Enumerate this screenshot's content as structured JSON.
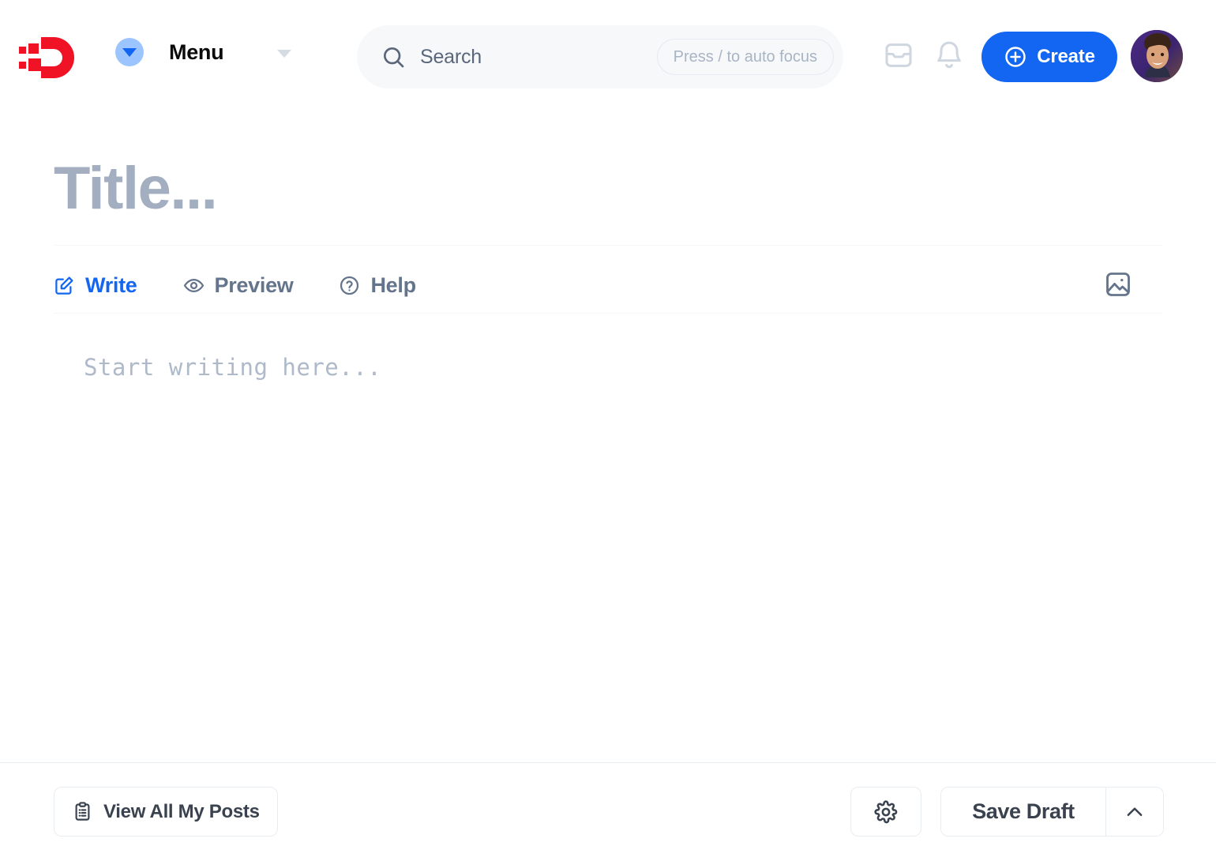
{
  "header": {
    "logo_icon": "dev-to-logo-icon",
    "menu": {
      "label": "Menu",
      "toggle_icon": "caret-down-filled-icon",
      "dropdown_icon": "chevron-down-icon"
    },
    "search": {
      "icon": "search-icon",
      "placeholder": "Search",
      "hint": "Press / to auto focus"
    },
    "inbox_icon": "inbox-icon",
    "notifications_icon": "bell-icon",
    "create": {
      "label": "Create",
      "icon": "plus-circle-icon"
    },
    "avatar": "user-avatar"
  },
  "editor": {
    "title_placeholder": "Title...",
    "body_placeholder": "Start writing here...",
    "tabs": [
      {
        "label": "Write",
        "icon": "pencil-square-icon",
        "active": true
      },
      {
        "label": "Preview",
        "icon": "eye-icon",
        "active": false
      },
      {
        "label": "Help",
        "icon": "question-circle-icon",
        "active": false
      }
    ],
    "image_upload_icon": "image-icon"
  },
  "footer": {
    "view_posts_label": "View All My Posts",
    "view_posts_icon": "clipboard-list-icon",
    "settings_icon": "gear-icon",
    "save_label": "Save Draft",
    "save_more_icon": "chevron-up-icon"
  },
  "colors": {
    "brand_red": "#F01225",
    "accent_blue": "#1366F2",
    "placeholder_gray": "#A3AFC0",
    "border_gray": "#E8EDF2",
    "search_bg": "#F6F8FA"
  }
}
